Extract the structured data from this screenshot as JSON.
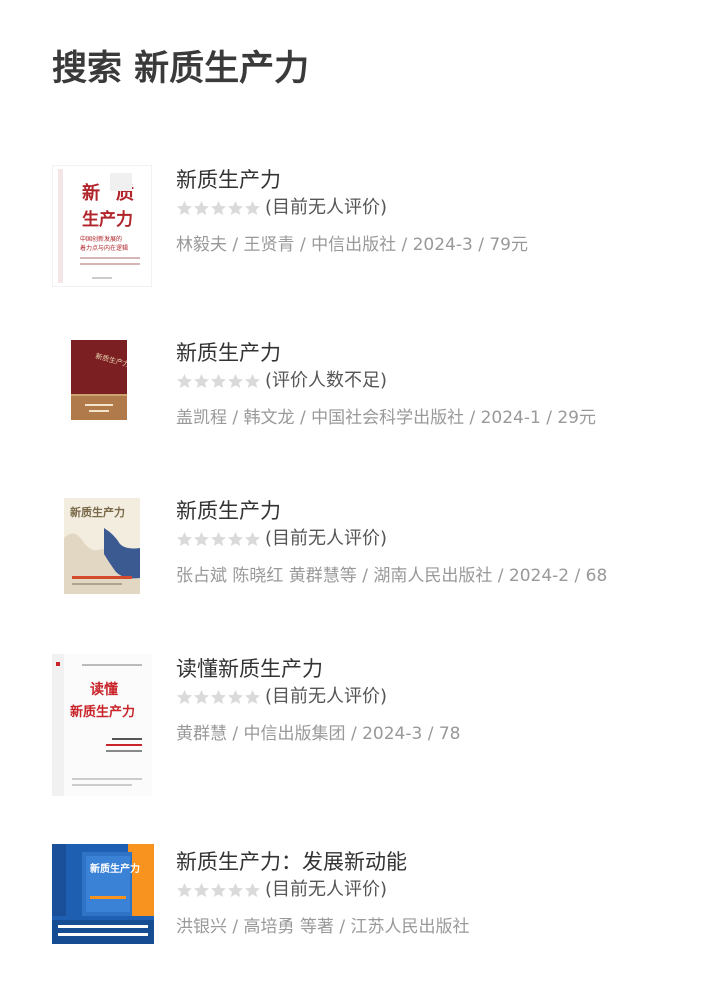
{
  "page": {
    "title": "搜索 新质生产力"
  },
  "colors": {
    "star_empty": "#dadada",
    "title_text": "#333333",
    "meta_text": "#999999"
  },
  "results": [
    {
      "title": "新质生产力",
      "stars_filled": 0,
      "rating_text": "(目前无人评价)",
      "meta": "林毅夫 / 王贤青 / 中信出版社 / 2024-3 / 79元",
      "cover_text": [
        "新",
        "质",
        "生产力",
        "中国创新发展的",
        "着力点与内在逻辑"
      ]
    },
    {
      "title": "新质生产力",
      "stars_filled": 0,
      "rating_text": "(评价人数不足)",
      "meta": "盖凯程 / 韩文龙 / 中国社会科学出版社 / 2024-1 / 29元",
      "cover_text": [
        "新质生产力"
      ]
    },
    {
      "title": "新质生产力",
      "stars_filled": 0,
      "rating_text": "(目前无人评价)",
      "meta": "张占斌 陈晓红 黄群慧等 / 湖南人民出版社 / 2024-2 / 68",
      "cover_text": [
        "新质生产力"
      ]
    },
    {
      "title": "读懂新质生产力",
      "stars_filled": 0,
      "rating_text": "(目前无人评价)",
      "meta": "黄群慧 / 中信出版集团 / 2024-3 / 78",
      "cover_text": [
        "读懂",
        "新质生产力"
      ]
    },
    {
      "title": "新质生产力：发展新动能",
      "stars_filled": 0,
      "rating_text": "(目前无人评价)",
      "meta": "洪银兴 / 高培勇 等著 / 江苏人民出版社",
      "cover_text": [
        "新质生产力"
      ]
    }
  ]
}
